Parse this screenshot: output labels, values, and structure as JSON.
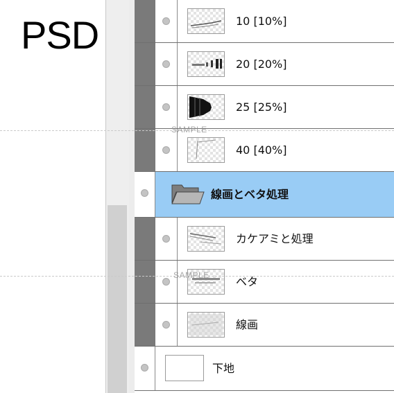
{
  "watermark_label": "PSD",
  "sample_watermark": "SAMPLE",
  "layers": [
    {
      "name": "10 [10%]",
      "kind": "clipped"
    },
    {
      "name": "20 [20%]",
      "kind": "clipped"
    },
    {
      "name": "25 [25%]",
      "kind": "clipped"
    },
    {
      "name": "40 [40%]",
      "kind": "clipped"
    },
    {
      "name": "線画とベタ処理",
      "kind": "folder",
      "selected": true
    },
    {
      "name": "カケアミと処理",
      "kind": "clipped"
    },
    {
      "name": "ベタ",
      "kind": "clipped"
    },
    {
      "name": "線画",
      "kind": "clipped"
    },
    {
      "name": "下地",
      "kind": "base"
    }
  ],
  "colors": {
    "selection": "#99ccf5",
    "clip_bar": "#7a7a7a"
  },
  "icons": [
    "visibility-dot-icon",
    "folder-open-icon"
  ]
}
